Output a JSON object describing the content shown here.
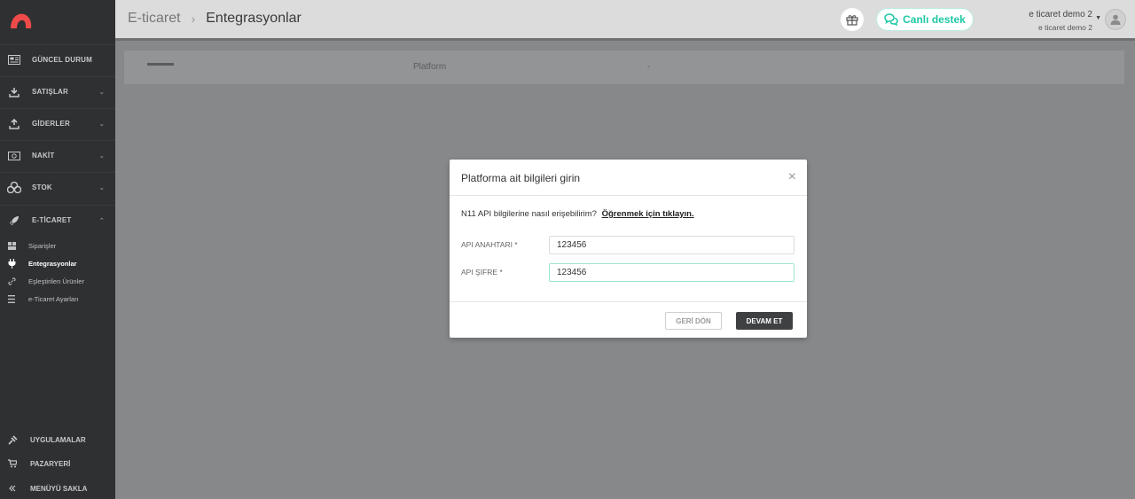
{
  "colors": {
    "sidebar_bg": "#2f3031",
    "accent": "#1ec8a5",
    "logo": "#ef4a4a",
    "overlay": "#87888a"
  },
  "sidebar": {
    "items": [
      {
        "label": "GÜNCEL DURUM",
        "icon": "dashboard-icon"
      },
      {
        "label": "SATIŞLAR",
        "icon": "sales-icon",
        "chevron": "⌄"
      },
      {
        "label": "GİDERLER",
        "icon": "expenses-icon",
        "chevron": "⌄"
      },
      {
        "label": "NAKİT",
        "icon": "cash-icon",
        "chevron": "⌄"
      },
      {
        "label": "STOK",
        "icon": "stock-icon",
        "chevron": "⌄"
      },
      {
        "label": "E-TİCARET",
        "icon": "rocket-icon",
        "chevron": "⌃"
      }
    ],
    "subitems": [
      {
        "label": "Siparişler",
        "icon": "orders-icon"
      },
      {
        "label": "Entegrasyonlar",
        "icon": "plug-icon",
        "active": true
      },
      {
        "label": "Eşleştirilen Ürünler",
        "icon": "link-icon"
      },
      {
        "label": "e-Ticaret Ayarları",
        "icon": "settings-list-icon"
      }
    ],
    "bottom": [
      {
        "label": "UYGULAMALAR",
        "icon": "apps-icon"
      },
      {
        "label": "PAZARYERİ",
        "icon": "cart-icon"
      },
      {
        "label": "MENÜYÜ SAKLA",
        "icon": "collapse-icon"
      }
    ]
  },
  "header": {
    "breadcrumb_parent": "E-ticaret",
    "breadcrumb_sep": "›",
    "breadcrumb_current": "Entegrasyonlar",
    "live_support_label": "Canlı destek",
    "user_name": "e ticaret demo 2",
    "user_company": "e ticaret demo 2"
  },
  "background_table": {
    "col_platform": "Platform",
    "col_dash": "-"
  },
  "modal": {
    "title": "Platforma ait bilgileri girin",
    "close": "×",
    "help_text": "N11 API bilgilerine nasıl erişebilirim?",
    "help_link": "Öğrenmek için tıklayın.",
    "fields": [
      {
        "label": "API ANAHTARI *",
        "value": "123456"
      },
      {
        "label": "API ŞİFRE *",
        "value": "123456"
      }
    ],
    "back_label": "GERİ DÖN",
    "next_label": "DEVAM ET"
  }
}
